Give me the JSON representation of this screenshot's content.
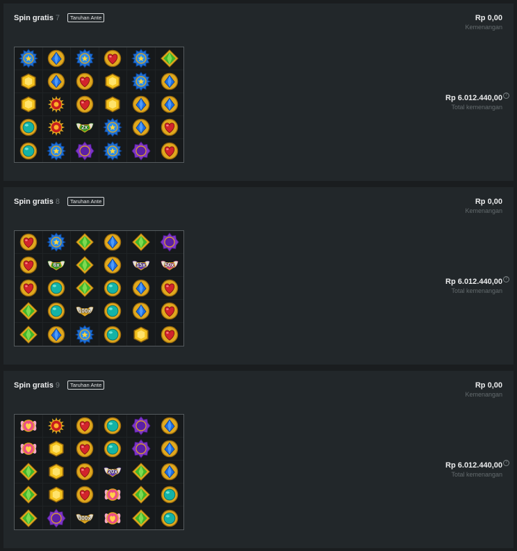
{
  "labels": {
    "spin_title": "Spin gratis",
    "ante_badge": "Taruhan Ante",
    "win_label": "Kemenangan",
    "total_label": "Total kemenangan",
    "help_glyph": "?"
  },
  "spins": [
    {
      "number": "7",
      "win_value": "Rp 0,00",
      "total_value": "Rp 6.012.440,00",
      "grid": [
        [
          "blue-star",
          "blue-gem",
          "blue-star",
          "red-heart",
          "blue-star",
          "green-gem"
        ],
        [
          "yellow-gem",
          "blue-gem",
          "red-heart",
          "yellow-gem",
          "blue-star",
          "blue-gem"
        ],
        [
          "yellow-gem",
          "red-sun",
          "red-heart",
          "yellow-gem",
          "blue-gem",
          "blue-gem"
        ],
        [
          "teal-gem",
          "red-sun",
          {
            "type": "green-wing",
            "mult": "2x"
          },
          "blue-star",
          "blue-gem",
          "red-heart"
        ],
        [
          "teal-gem",
          "blue-star",
          "purple-moon",
          "blue-star",
          "purple-moon",
          "red-heart"
        ]
      ]
    },
    {
      "number": "8",
      "win_value": "Rp 0,00",
      "total_value": "Rp 6.012.440,00",
      "grid": [
        [
          "red-heart",
          "blue-star",
          "green-gem",
          "blue-gem",
          "green-gem",
          "purple-moon"
        ],
        [
          "red-heart",
          {
            "type": "green-wing",
            "mult": "6x"
          },
          "green-gem",
          "blue-gem",
          {
            "type": "purple-wing",
            "mult": "15x"
          },
          {
            "type": "pink-wing",
            "mult": "50x"
          }
        ],
        [
          "red-heart",
          "teal-gem",
          "green-gem",
          "teal-gem",
          "blue-gem",
          "red-heart"
        ],
        [
          "green-gem",
          "teal-gem",
          {
            "type": "gold-wing",
            "mult": "100x"
          },
          "teal-gem",
          "blue-gem",
          "red-heart"
        ],
        [
          "green-gem",
          "blue-gem",
          "blue-star",
          "teal-gem",
          "yellow-gem",
          "red-heart"
        ]
      ]
    },
    {
      "number": "9",
      "win_value": "Rp 0,00",
      "total_value": "Rp 6.012.440,00",
      "grid": [
        [
          "pink-orb",
          "red-sun",
          "red-heart",
          "teal-gem",
          "purple-moon",
          "blue-gem"
        ],
        [
          "pink-orb",
          "yellow-gem",
          "red-heart",
          "teal-gem",
          "purple-moon",
          "blue-gem"
        ],
        [
          "green-gem",
          "yellow-gem",
          "red-heart",
          {
            "type": "purple-wing",
            "mult": "20x"
          },
          "green-gem",
          "blue-gem"
        ],
        [
          "green-gem",
          "yellow-gem",
          "red-heart",
          "pink-orb",
          "green-gem",
          "teal-gem"
        ],
        [
          "green-gem",
          "purple-moon",
          {
            "type": "gold-wing",
            "mult": "300x"
          },
          "pink-orb",
          "green-gem",
          "teal-gem"
        ]
      ]
    }
  ]
}
